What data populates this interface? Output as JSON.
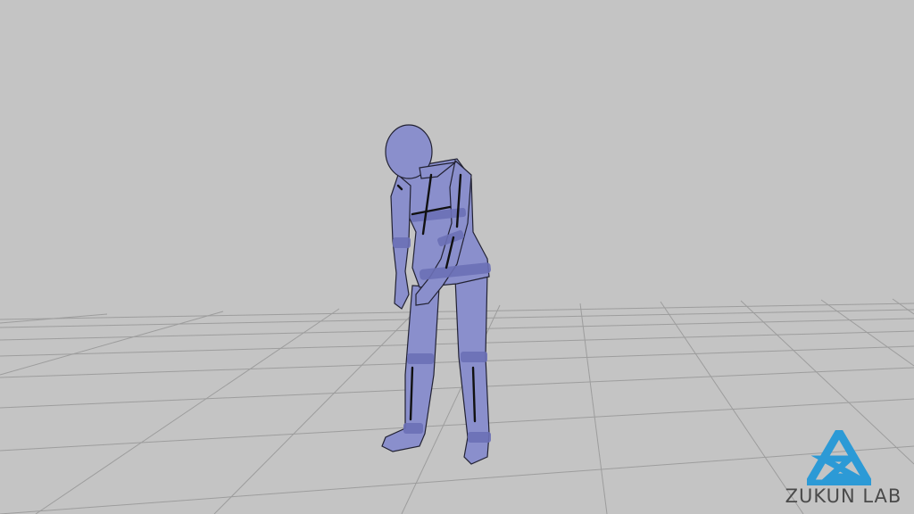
{
  "scene": {
    "background_color": "#c4c4c4",
    "grid_color": "#9d9d9d",
    "figure_color": "#8a8fcc",
    "figure_band_color": "#6c70b6",
    "figure_outline_color": "#222233"
  },
  "logo": {
    "text": "ZUKUN LAB",
    "mark_color": "#2c9ad6",
    "icon": "triangle-z-logo-icon"
  }
}
